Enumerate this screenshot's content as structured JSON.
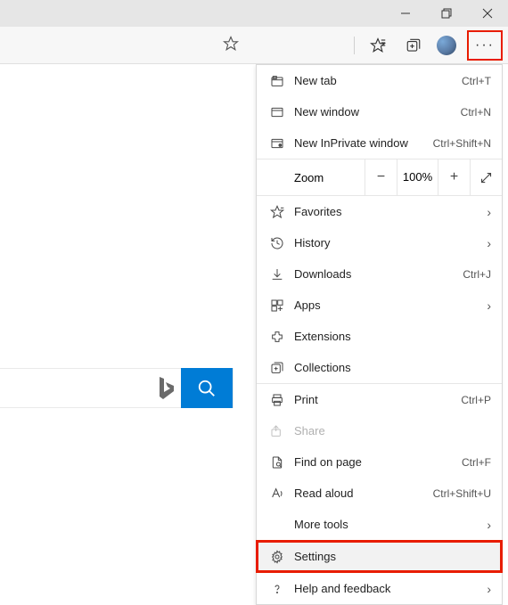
{
  "window_controls": {
    "min": "—",
    "max": "❐",
    "close": "✕"
  },
  "toolbar": {
    "more_dots": "···"
  },
  "zoom": {
    "label": "Zoom",
    "value": "100%",
    "minus": "−",
    "plus": "+"
  },
  "menu": {
    "new_tab": {
      "label": "New tab",
      "shortcut": "Ctrl+T"
    },
    "new_window": {
      "label": "New window",
      "shortcut": "Ctrl+N"
    },
    "new_inprivate": {
      "label": "New InPrivate window",
      "shortcut": "Ctrl+Shift+N"
    },
    "favorites": {
      "label": "Favorites"
    },
    "history": {
      "label": "History"
    },
    "downloads": {
      "label": "Downloads",
      "shortcut": "Ctrl+J"
    },
    "apps": {
      "label": "Apps"
    },
    "extensions": {
      "label": "Extensions"
    },
    "collections": {
      "label": "Collections"
    },
    "print": {
      "label": "Print",
      "shortcut": "Ctrl+P"
    },
    "share": {
      "label": "Share"
    },
    "find": {
      "label": "Find on page",
      "shortcut": "Ctrl+F"
    },
    "read_aloud": {
      "label": "Read aloud",
      "shortcut": "Ctrl+Shift+U"
    },
    "more_tools": {
      "label": "More tools"
    },
    "settings": {
      "label": "Settings"
    },
    "help": {
      "label": "Help and feedback"
    }
  }
}
